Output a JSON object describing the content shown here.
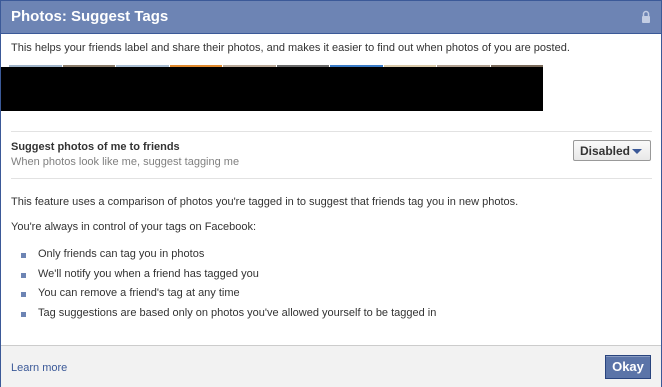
{
  "dialog": {
    "title": "Photos: Suggest Tags",
    "icon": "lock-icon",
    "intro": "This helps your friends label and share their photos, and makes it easier to find out when photos of you are posted.",
    "thumbnail_accent_colors": [
      "#9fb3c8",
      "#8b7d6b",
      "#a8bcd0",
      "#e08a2e",
      "#b8a898",
      "#6b6b6b",
      "#3a7cc8",
      "#d8c8a8",
      "#b0a090",
      "#7a6a5a"
    ],
    "setting": {
      "title": "Suggest photos of me to friends",
      "subtitle": "When photos look like me, suggest tagging me",
      "dropdown_value": "Disabled"
    },
    "paragraph_1": "This feature uses a comparison of photos you're tagged in to suggest that friends tag you in new photos.",
    "paragraph_2": "You're always in control of your tags on Facebook:",
    "bullets": [
      "Only friends can tag you in photos",
      "We'll notify you when a friend has tagged you",
      "You can remove a friend's tag at any time",
      "Tag suggestions are based only on photos you've allowed yourself to be tagged in"
    ],
    "footer": {
      "learn_more": "Learn more",
      "okay": "Okay"
    },
    "colors": {
      "titlebar": "#6d84b4",
      "border": "#3b5998",
      "link": "#3b5998",
      "button": "#5b74a8"
    }
  }
}
